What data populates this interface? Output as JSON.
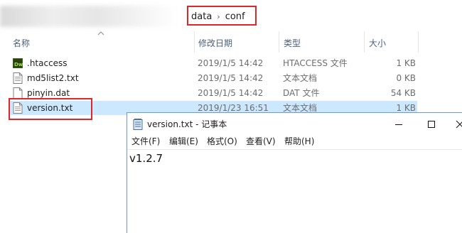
{
  "breadcrumb": {
    "items": [
      "data",
      "conf"
    ]
  },
  "columns": {
    "name": "名称",
    "date": "修改日期",
    "type": "类型",
    "size": "大小"
  },
  "files": [
    {
      "name": ".htaccess",
      "date": "2019/1/5 14:42",
      "type": "HTACCESS 文件",
      "size": "1 KB",
      "icon": "dreamweaver-file-icon"
    },
    {
      "name": "md5list2.txt",
      "date": "2019/1/5 14:42",
      "type": "文本文档",
      "size": "0 KB",
      "icon": "text-file-icon"
    },
    {
      "name": "pinyin.dat",
      "date": "2019/1/5 14:42",
      "type": "DAT 文件",
      "size": "54 KB",
      "icon": "blank-file-icon"
    },
    {
      "name": "version.txt",
      "date": "2019/1/23 16:51",
      "type": "文本文档",
      "size": "1 KB",
      "icon": "text-file-icon",
      "selected": true
    }
  ],
  "notepad": {
    "title": "version.txt - 记事本",
    "menu": [
      "文件(F)",
      "编辑(E)",
      "格式(O)",
      "查看(V)",
      "帮助(H)"
    ],
    "content": "v1.2.7"
  },
  "colors": {
    "highlight": "#e0262b",
    "selection": "#cce8ff",
    "header_text": "#4c607a"
  }
}
